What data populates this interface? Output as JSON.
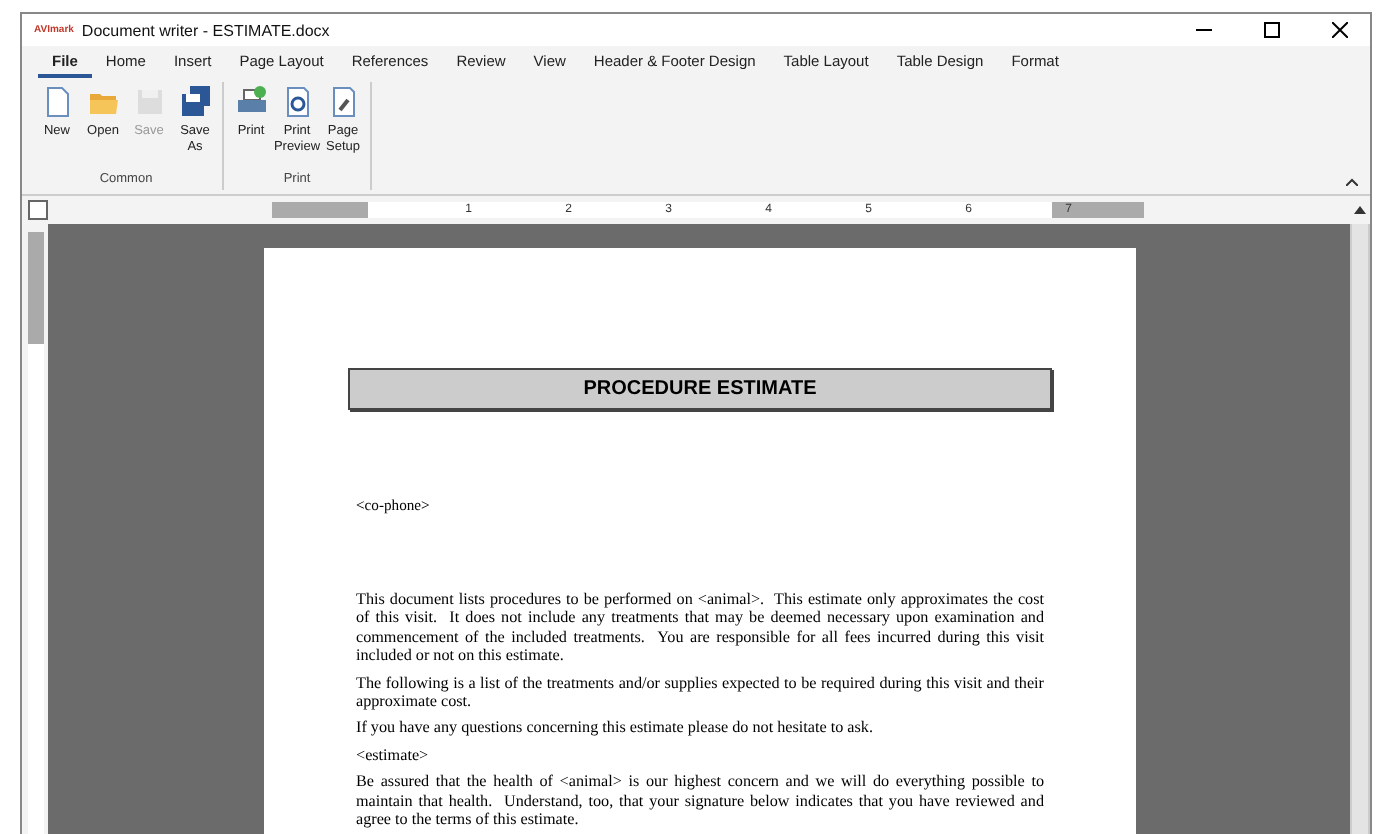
{
  "window": {
    "title": "Document writer - ESTIMATE.docx",
    "app_icon": "AVImark"
  },
  "tabs": [
    {
      "label": "File",
      "selected": true
    },
    {
      "label": "Home",
      "selected": false
    },
    {
      "label": "Insert",
      "selected": false
    },
    {
      "label": "Page Layout",
      "selected": false
    },
    {
      "label": "References",
      "selected": false
    },
    {
      "label": "Review",
      "selected": false
    },
    {
      "label": "View",
      "selected": false
    },
    {
      "label": "Header & Footer Design",
      "selected": false
    },
    {
      "label": "Table Layout",
      "selected": false
    },
    {
      "label": "Table Design",
      "selected": false
    },
    {
      "label": "Format",
      "selected": false
    }
  ],
  "ribbon_groups": [
    {
      "label": "Common",
      "buttons": [
        {
          "kind": "new",
          "label": "New",
          "disabled": false
        },
        {
          "kind": "open",
          "label": "Open",
          "disabled": false
        },
        {
          "kind": "save",
          "label": "Save",
          "disabled": true
        },
        {
          "kind": "saveas",
          "label": "Save As",
          "disabled": false
        }
      ]
    },
    {
      "label": "Print",
      "buttons": [
        {
          "kind": "print",
          "label": "Print",
          "disabled": false
        },
        {
          "kind": "preview",
          "label": "Print Preview",
          "disabled": false
        },
        {
          "kind": "setup",
          "label": "Page Setup",
          "disabled": false
        }
      ]
    }
  ],
  "ruler": {
    "labels": [
      "1",
      "2",
      "3",
      "4",
      "5",
      "6",
      "7"
    ]
  },
  "document": {
    "title": "PROCEDURE ESTIMATE",
    "phone": "<co-phone>",
    "paragraphs": [
      "This document lists procedures to be performed on <animal>.  This estimate only approximates the cost of this visit.  It does not include any treatments that may be deemed necessary upon examination and commencement of the included treatments.  You are responsible for all fees incurred during this visit included or not on this estimate.",
      "The following is a list of the treatments and/or supplies expected to be required during this visit and their approximate cost.",
      "If you have any questions concerning this estimate please do not hesitate to ask.",
      "<estimate>",
      "Be assured that the health of <animal> is our highest concern and we will do everything possible to maintain that health.  Understand, too, that your signature below indicates that you have reviewed and agree to the terms of this estimate."
    ]
  }
}
